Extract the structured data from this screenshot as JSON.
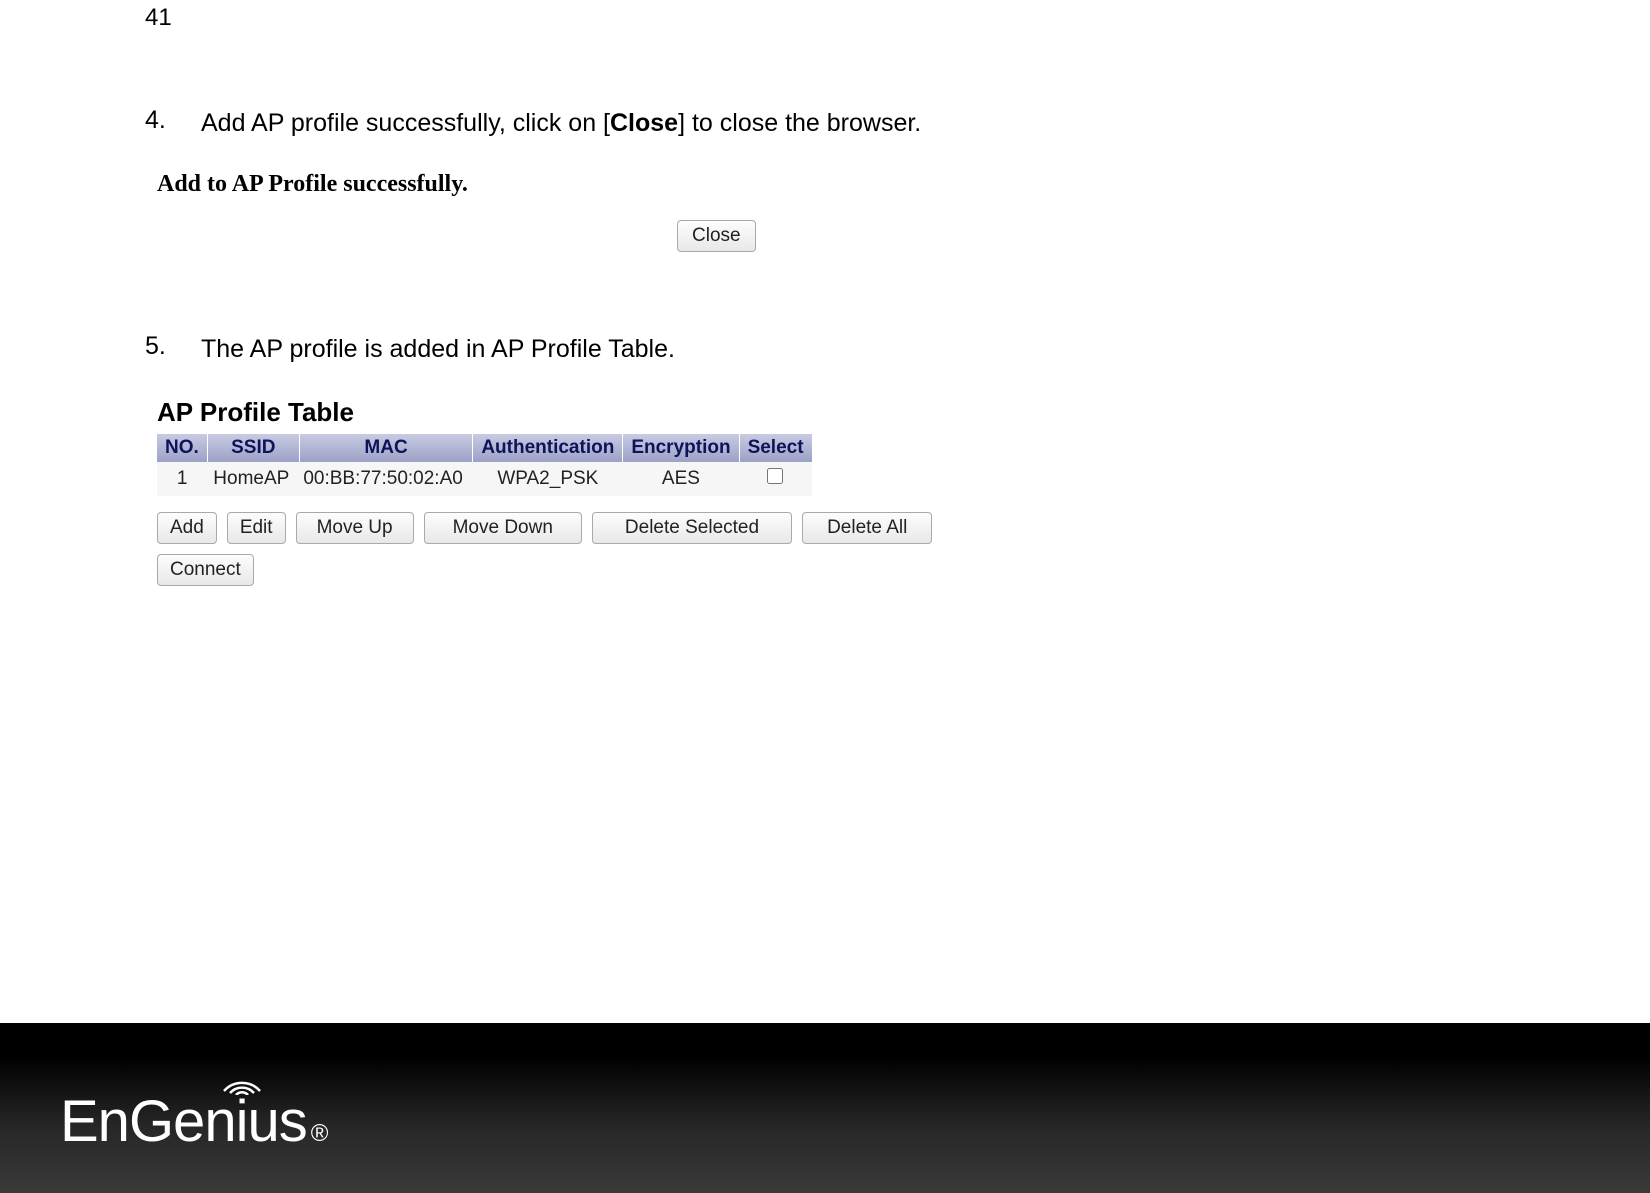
{
  "page_number": "41",
  "steps": {
    "s4": {
      "num": "4.",
      "pre": "Add AP profile successfully, click on [",
      "bold": "Close",
      "post": "] to close the browser."
    },
    "s5": {
      "num": "5.",
      "text": "The AP profile is added in AP Profile Table."
    }
  },
  "screenshot1": {
    "title": "Add to AP Profile successfully.",
    "close_btn": "Close"
  },
  "screenshot2": {
    "title": "AP Profile Table",
    "headers": {
      "no": "NO.",
      "ssid": "SSID",
      "mac": "MAC",
      "auth": "Authentication",
      "enc": "Encryption",
      "sel": "Select"
    },
    "row1": {
      "no": "1",
      "ssid": "HomeAP",
      "mac": "00:BB:77:50:02:A0",
      "auth": "WPA2_PSK",
      "enc": "AES"
    },
    "buttons": {
      "add": "Add",
      "edit": "Edit",
      "moveup": "Move Up",
      "movedown": "Move Down",
      "delsel": "Delete Selected",
      "delall": "Delete All",
      "connect": "Connect"
    }
  },
  "footer": {
    "logo_pre": "EnGen",
    "logo_i": "i",
    "logo_post": "us",
    "reg": "®"
  }
}
